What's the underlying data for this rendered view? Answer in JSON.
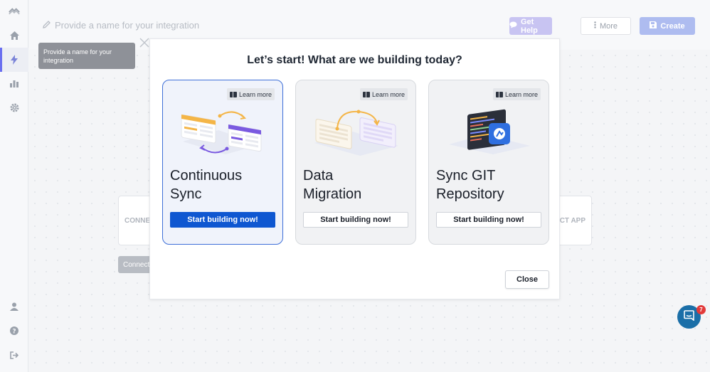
{
  "header": {
    "name_placeholder": "Provide a name for your integration",
    "get_help_label": "Get Help",
    "more_label": "More",
    "create_label": "Create"
  },
  "tooltip": {
    "text": "Provide a name for your integration"
  },
  "background": {
    "left_box_label": "CONNE",
    "right_box_label": "ECT APP",
    "connect_button_label": "Connect t"
  },
  "modal": {
    "title": "Let’s start! What are we building today?",
    "cards": [
      {
        "title_line1": "Continuous",
        "title_line2": "Sync",
        "learn_more": "Learn more",
        "button": "Start building now!",
        "selected": true
      },
      {
        "title_line1": "Data",
        "title_line2": "Migration",
        "learn_more": "Learn more",
        "button": "Start building now!",
        "selected": false
      },
      {
        "title_line1": "Sync GIT",
        "title_line2": "Repository",
        "learn_more": "Learn more",
        "button": "Start building now!",
        "selected": false
      }
    ],
    "close_label": "Close"
  },
  "sidebar": {
    "top_icons": [
      "logo-icon",
      "home-icon",
      "lightning-icon",
      "chart-icon",
      "gear-icon"
    ],
    "bottom_icons": [
      "user-icon",
      "help-icon",
      "logout-icon"
    ]
  },
  "chat": {
    "badge_count": "7"
  },
  "colors": {
    "primary": "#0f57d1",
    "selected_border": "#3d6fd8",
    "help_button": "#c8c4f2",
    "create_button": "#aebcf0",
    "chat_bubble": "#1b6fa8",
    "badge": "#e23a3a"
  }
}
